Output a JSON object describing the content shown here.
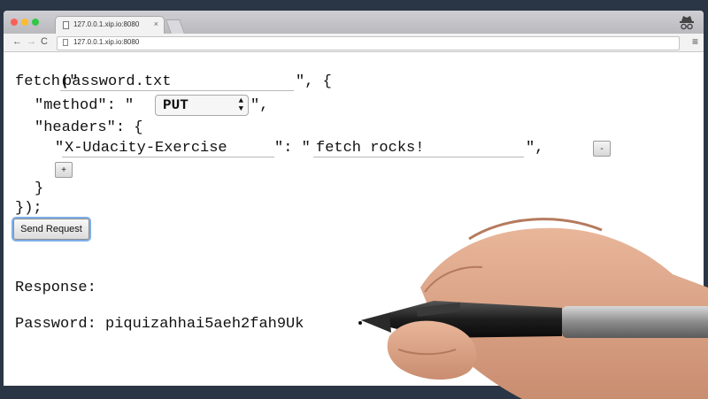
{
  "browser": {
    "tab_title": "127.0.0.1.xip.io:8080",
    "tab_close": "×",
    "url": "127.0.0.1.xip.io:8080",
    "back": "←",
    "forward": "→",
    "reload": "C",
    "menu": "≡"
  },
  "code": {
    "fetch_open": "fetch(\"",
    "url_value": "password.txt",
    "after_url": "\", {",
    "method_prefix": "\"method\": \"",
    "method_value": "PUT",
    "method_suffix": "\",",
    "headers_prefix": "\"headers\": {",
    "header_open_quote": "\"",
    "header_name": "X-Udacity-Exercise",
    "header_colon": "\": \"",
    "header_value": "fetch rocks!",
    "header_close": "\",",
    "remove_header_button": "-",
    "add_header_button": "+",
    "inner_close": "}",
    "outer_close": "});"
  },
  "send_button": "Send Request",
  "response": {
    "label": "Response:",
    "body": "Password: piquizahhai5aeh2fah9Uk"
  },
  "colors": {
    "focus_ring": "#7eaee8",
    "background": "#2a3645"
  }
}
